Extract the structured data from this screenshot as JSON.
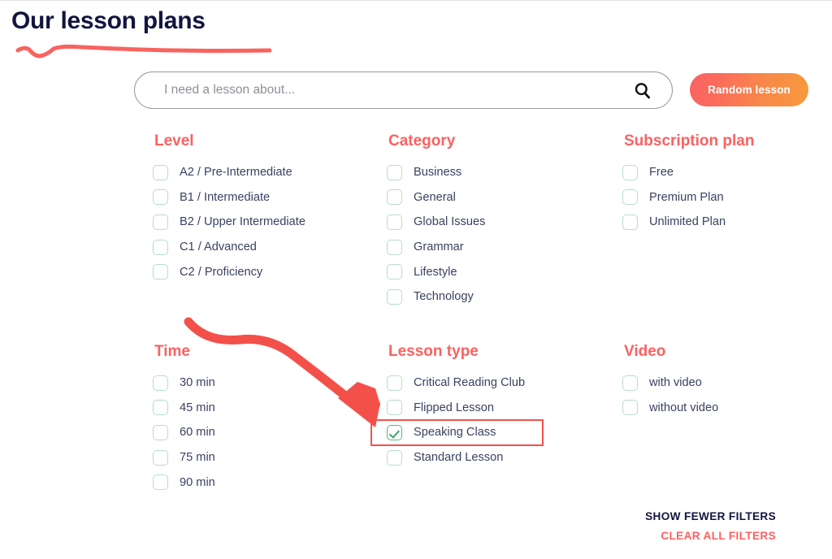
{
  "header": {
    "title": "Our lesson plans"
  },
  "search": {
    "placeholder": "I need a lesson about...",
    "value": "",
    "icon": "search-icon",
    "random_button_label": "Random lesson"
  },
  "colors": {
    "accent_coral": "#FC6161",
    "title_navy": "#131440",
    "label_slate": "#3A4162",
    "checkbox_border": "#B6DDCA",
    "checkbox_checked": "#3DA46C",
    "annotation_red": "#F4504A",
    "button_gradient_start": "#FA6363",
    "button_gradient_end": "#F79A3B"
  },
  "filters": [
    {
      "id": "level",
      "title": "Level",
      "options": [
        {
          "label": "A2 / Pre-Intermediate",
          "checked": false
        },
        {
          "label": "B1 / Intermediate",
          "checked": false
        },
        {
          "label": "B2 / Upper Intermediate",
          "checked": false
        },
        {
          "label": "C1 / Advanced",
          "checked": false
        },
        {
          "label": "C2 / Proficiency",
          "checked": false
        }
      ]
    },
    {
      "id": "category",
      "title": "Category",
      "options": [
        {
          "label": "Business",
          "checked": false
        },
        {
          "label": "General",
          "checked": false
        },
        {
          "label": "Global Issues",
          "checked": false
        },
        {
          "label": "Grammar",
          "checked": false
        },
        {
          "label": "Lifestyle",
          "checked": false
        },
        {
          "label": "Technology",
          "checked": false
        }
      ]
    },
    {
      "id": "subscription-plan",
      "title": "Subscription plan",
      "options": [
        {
          "label": "Free",
          "checked": false
        },
        {
          "label": "Premium Plan",
          "checked": false
        },
        {
          "label": "Unlimited Plan",
          "checked": false
        }
      ]
    },
    {
      "id": "time",
      "title": "Time",
      "options": [
        {
          "label": "30 min",
          "checked": false
        },
        {
          "label": "45 min",
          "checked": false
        },
        {
          "label": "60 min",
          "checked": false
        },
        {
          "label": "75 min",
          "checked": false
        },
        {
          "label": "90 min",
          "checked": false
        }
      ]
    },
    {
      "id": "lesson-type",
      "title": "Lesson type",
      "options": [
        {
          "label": "Critical Reading Club",
          "checked": false
        },
        {
          "label": "Flipped Lesson",
          "checked": false
        },
        {
          "label": "Speaking Class",
          "checked": true
        },
        {
          "label": "Standard Lesson",
          "checked": false
        }
      ]
    },
    {
      "id": "video",
      "title": "Video",
      "options": [
        {
          "label": "with video",
          "checked": false
        },
        {
          "label": "without video",
          "checked": false
        }
      ]
    }
  ],
  "footer": {
    "show_fewer_label": "SHOW FEWER FILTERS",
    "clear_all_label": "CLEAR ALL FILTERS"
  },
  "annotations": {
    "arrow": "curved-arrow pointing to Speaking Class option",
    "highlight_rect": "red rectangle around Speaking Class option",
    "title_underline": "hand-drawn coral underline"
  }
}
